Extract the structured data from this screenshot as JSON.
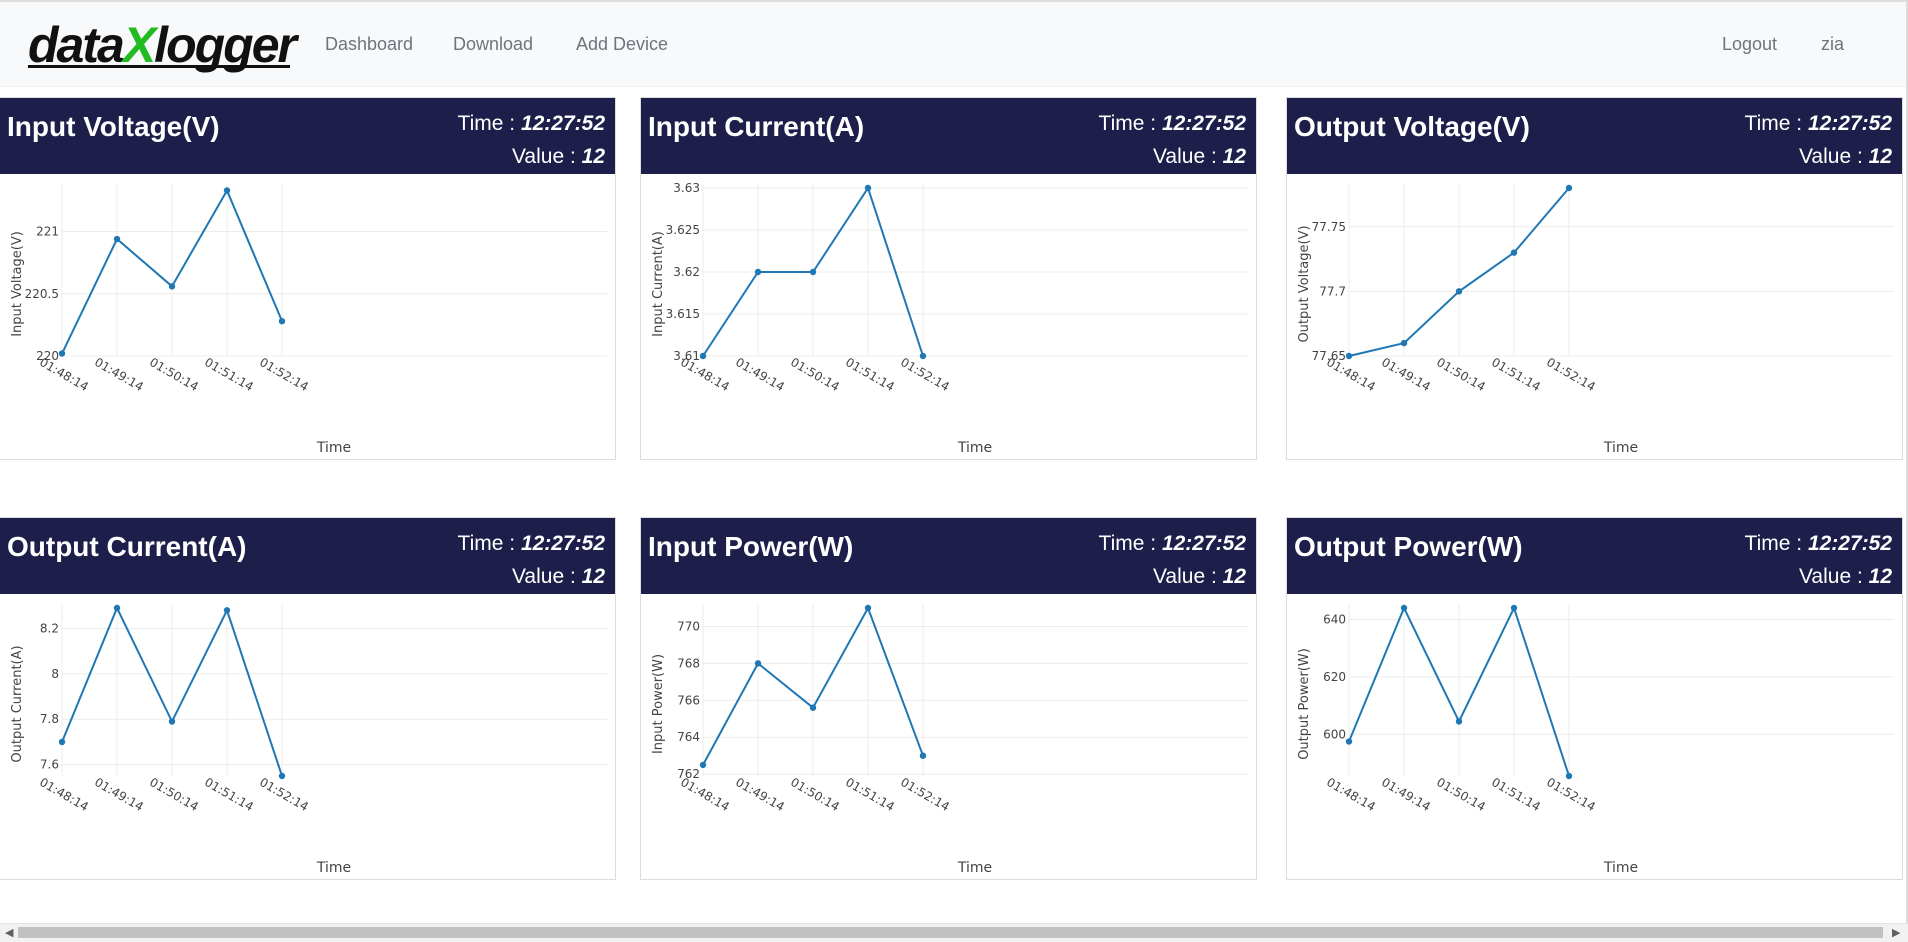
{
  "navbar": {
    "logo_prefix": "data",
    "logo_x": "X",
    "logo_suffix": "logger",
    "links": [
      "Dashboard",
      "Download",
      "Add Device"
    ],
    "logout": "Logout",
    "user": "zia"
  },
  "labels": {
    "time": "Time : ",
    "value": "Value : "
  },
  "colors": {
    "header_bg": "#1d1f4a",
    "line": "#1f77b4",
    "logo_x": "#22bb22"
  },
  "cards": [
    {
      "title": "Input Voltage(V)",
      "time": "12:27:52",
      "value": "12"
    },
    {
      "title": "Input Current(A)",
      "time": "12:27:52",
      "value": "12"
    },
    {
      "title": "Output Voltage(V)",
      "time": "12:27:52",
      "value": "12"
    },
    {
      "title": "Output Current(A)",
      "time": "12:27:52",
      "value": "12"
    },
    {
      "title": "Input Power(W)",
      "time": "12:27:52",
      "value": "12"
    },
    {
      "title": "Output Power(W)",
      "time": "12:27:52",
      "value": "12"
    }
  ],
  "chart_data": [
    {
      "type": "line",
      "x": [
        "01:48:14",
        "01:49:14",
        "01:50:14",
        "01:51:14",
        "01:52:14"
      ],
      "values": [
        220.02,
        220.94,
        220.56,
        221.33,
        220.28
      ],
      "ylim": [
        220,
        221.35
      ],
      "yticks": [
        "220",
        "220.5",
        "221"
      ],
      "ytick_values": [
        220,
        220.5,
        221
      ],
      "xlabel": "Time",
      "ylabel": "Input Voltage(V)"
    },
    {
      "type": "line",
      "x": [
        "01:48:14",
        "01:49:14",
        "01:50:14",
        "01:51:14",
        "01:52:14"
      ],
      "values": [
        3.61,
        3.62,
        3.62,
        3.63,
        3.61
      ],
      "ylim": [
        3.61,
        3.63
      ],
      "yticks": [
        "3.61",
        "3.615",
        "3.62",
        "3.625",
        "3.63"
      ],
      "ytick_values": [
        3.61,
        3.615,
        3.62,
        3.625,
        3.63
      ],
      "xlabel": "Time",
      "ylabel": "Input Current(A)"
    },
    {
      "type": "line",
      "x": [
        "01:48:14",
        "01:49:14",
        "01:50:14",
        "01:51:14",
        "01:52:14"
      ],
      "values": [
        77.65,
        77.66,
        77.7,
        77.73,
        77.78
      ],
      "ylim": [
        77.65,
        77.78
      ],
      "yticks": [
        "77.65",
        "77.7",
        "77.75"
      ],
      "ytick_values": [
        77.65,
        77.7,
        77.75
      ],
      "xlabel": "Time",
      "ylabel": "Output Voltage(V)"
    },
    {
      "type": "line",
      "x": [
        "01:48:14",
        "01:49:14",
        "01:50:14",
        "01:51:14",
        "01:52:14"
      ],
      "values": [
        7.7,
        8.29,
        7.79,
        8.28,
        7.55
      ],
      "ylim": [
        7.55,
        8.29
      ],
      "yticks": [
        "7.6",
        "7.8",
        "8",
        "8.2"
      ],
      "ytick_values": [
        7.6,
        7.8,
        8,
        8.2
      ],
      "xlabel": "Time",
      "ylabel": "Output Current(A)"
    },
    {
      "type": "line",
      "x": [
        "01:48:14",
        "01:49:14",
        "01:50:14",
        "01:51:14",
        "01:52:14"
      ],
      "values": [
        762.5,
        768.0,
        765.6,
        771.0,
        763.0
      ],
      "ylim": [
        761.9,
        771.0
      ],
      "yticks": [
        "762",
        "764",
        "766",
        "768",
        "770"
      ],
      "ytick_values": [
        762,
        764,
        766,
        768,
        770
      ],
      "xlabel": "Time",
      "ylabel": "Input Power(W)"
    },
    {
      "type": "line",
      "x": [
        "01:48:14",
        "01:49:14",
        "01:50:14",
        "01:51:14",
        "01:52:14"
      ],
      "values": [
        597.5,
        644.0,
        604.5,
        644.0,
        585.5
      ],
      "ylim": [
        585.5,
        644.0
      ],
      "yticks": [
        "600",
        "620",
        "640"
      ],
      "ytick_values": [
        600,
        620,
        640
      ],
      "xlabel": "Time",
      "ylabel": "Output Power(W)"
    }
  ]
}
